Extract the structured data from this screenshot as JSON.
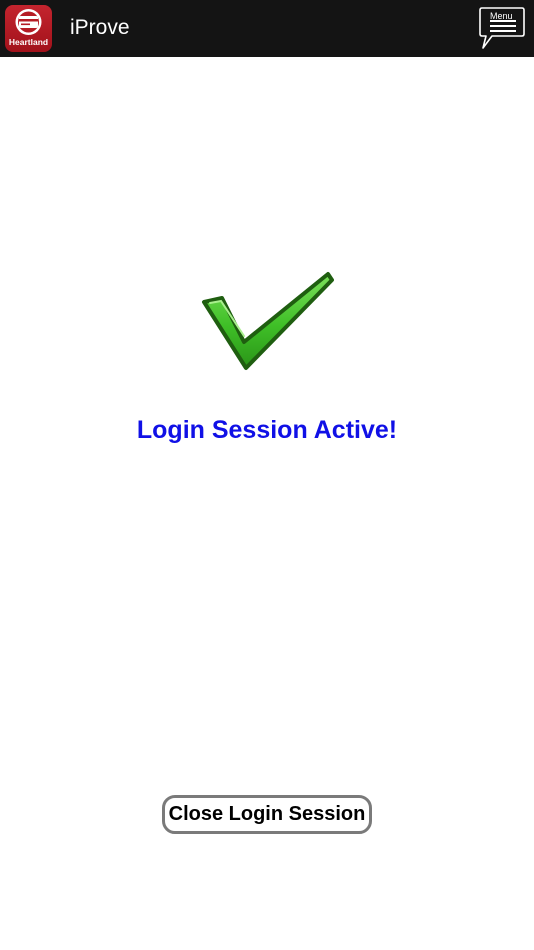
{
  "header": {
    "logo_text": "Heartland",
    "app_title": "iProve",
    "menu_label": "Menu",
    "logo_icon": "heartland-logo-icon",
    "menu_icon": "hamburger-chat-bubble-icon"
  },
  "main": {
    "status_icon": "checkmark-icon",
    "status_text": "Login Session Active!",
    "close_button_label": "Close Login Session"
  },
  "colors": {
    "header_bg": "#141414",
    "logo_red": "#b51c25",
    "status_blue": "#1010e6",
    "check_green": "#46c42e",
    "button_border": "#7a7a7a"
  }
}
